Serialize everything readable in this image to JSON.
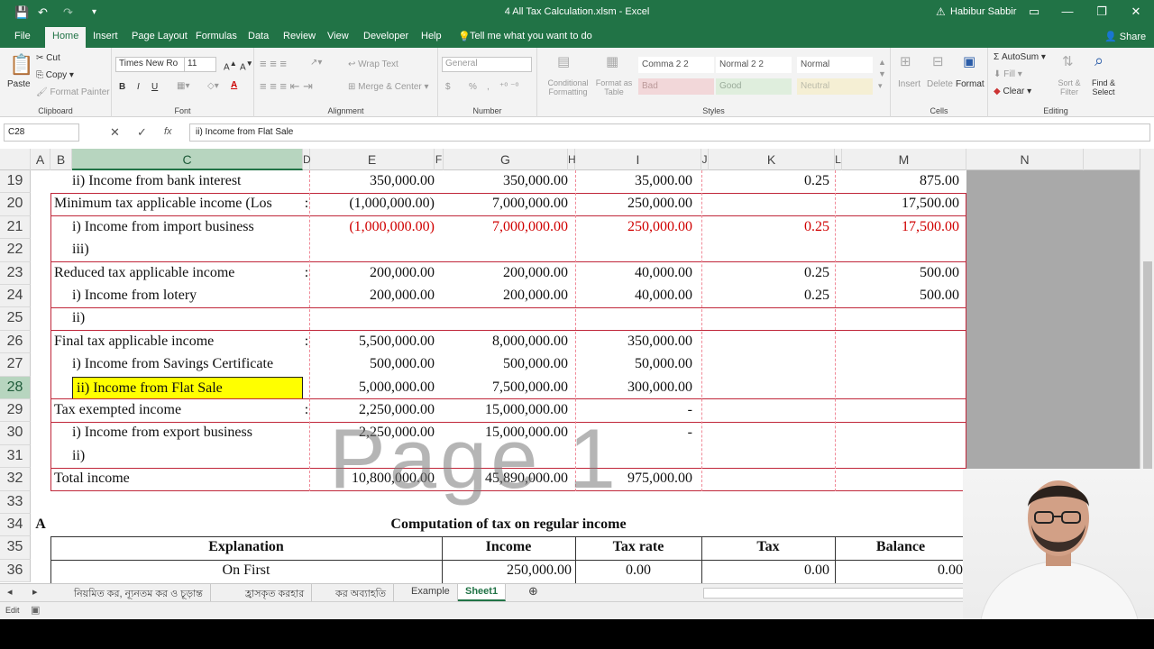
{
  "titlebar": {
    "title": "4 All Tax Calculation.xlsm  -  Excel",
    "user": "Habibur Sabbir",
    "save_icon": "💾",
    "undo_icon": "↶",
    "redo_icon": "↷",
    "customize_icon": "▾",
    "warning_icon": "⚠",
    "ribbon_display_icon": "▭",
    "minimize_icon": "—",
    "restore_icon": "❐",
    "close_icon": "✕"
  },
  "menu_tabs": [
    "File",
    "Home",
    "Insert",
    "Page Layout",
    "Formulas",
    "Data",
    "Review",
    "View",
    "Developer",
    "Help"
  ],
  "tell_me": "Tell me what you want to do",
  "share": "Share",
  "ribbon": {
    "clipboard": {
      "paste": "Paste",
      "cut": "Cut",
      "copy": "Copy",
      "format_painter": "Format Painter",
      "label": "Clipboard"
    },
    "font": {
      "name": "Times New Ro",
      "size": "11",
      "bold": "B",
      "italic": "I",
      "underline": "U",
      "label": "Font"
    },
    "alignment": {
      "wrap": "Wrap Text",
      "merge": "Merge & Center",
      "label": "Alignment"
    },
    "number": {
      "format": "General",
      "currency": "$",
      "percent": "%",
      "comma": ",",
      "label": "Number"
    },
    "styles": {
      "conditional": "Conditional Formatting",
      "format_table": "Format as Table",
      "comma22": "Comma 2 2",
      "normal22": "Normal 2 2",
      "normal": "Normal",
      "bad": "Bad",
      "good": "Good",
      "neutral": "Neutral",
      "label": "Styles"
    },
    "cells": {
      "insert": "Insert",
      "delete": "Delete",
      "format": "Format",
      "label": "Cells"
    },
    "editing": {
      "autosum": "AutoSum",
      "fill": "Fill",
      "clear": "Clear",
      "sort": "Sort & Filter",
      "find": "Find & Select",
      "label": "Editing"
    }
  },
  "formula_bar": {
    "name_box": "C28",
    "cancel": "✕",
    "enter": "✓",
    "fx": "fx",
    "content": "ii) Income from Flat Sale"
  },
  "columns": [
    "A",
    "B",
    "C",
    "D",
    "E",
    "F",
    "G",
    "H",
    "I",
    "J",
    "K",
    "L",
    "M",
    "N"
  ],
  "rows": [
    {
      "num": "19",
      "c": "ii) Income from bank interest",
      "d": "",
      "e": "350,000.00",
      "g": "350,000.00",
      "i": "35,000.00",
      "k": "0.25",
      "m": "875.00"
    },
    {
      "num": "20",
      "c": "Minimum tax applicable income (Los",
      "d": ":",
      "e": "(1,000,000.00)",
      "g": "7,000,000.00",
      "i": "250,000.00",
      "k": "",
      "m": "17,500.00"
    },
    {
      "num": "21",
      "c": "i) Income from import business",
      "d": "",
      "e": "(1,000,000.00)",
      "g": "7,000,000.00",
      "i": "250,000.00",
      "k": "0.25",
      "m": "17,500.00"
    },
    {
      "num": "22",
      "c": "iii)",
      "d": "",
      "e": "",
      "g": "",
      "i": "",
      "k": "",
      "m": ""
    },
    {
      "num": "23",
      "c": "Reduced tax applicable income",
      "d": ":",
      "e": "200,000.00",
      "g": "200,000.00",
      "i": "40,000.00",
      "k": "0.25",
      "m": "500.00"
    },
    {
      "num": "24",
      "c": "i) Income from lotery",
      "d": "",
      "e": "200,000.00",
      "g": "200,000.00",
      "i": "40,000.00",
      "k": "0.25",
      "m": "500.00"
    },
    {
      "num": "25",
      "c": "ii)",
      "d": "",
      "e": "",
      "g": "",
      "i": "",
      "k": "",
      "m": ""
    },
    {
      "num": "26",
      "c": "Final tax applicable income",
      "d": ":",
      "e": "5,500,000.00",
      "g": "8,000,000.00",
      "i": "350,000.00",
      "k": "",
      "m": ""
    },
    {
      "num": "27",
      "c": "i) Income from Savings Certificate",
      "d": "",
      "e": "500,000.00",
      "g": "500,000.00",
      "i": "50,000.00",
      "k": "",
      "m": ""
    },
    {
      "num": "28",
      "c": "ii) Income from Flat Sale",
      "d": "",
      "e": "5,000,000.00",
      "g": "7,500,000.00",
      "i": "300,000.00",
      "k": "",
      "m": ""
    },
    {
      "num": "29",
      "c": "Tax exempted income",
      "d": ":",
      "e": "2,250,000.00",
      "g": "15,000,000.00",
      "i": "-",
      "k": "",
      "m": ""
    },
    {
      "num": "30",
      "c": "i) Income from export business",
      "d": "",
      "e": "2,250,000.00",
      "g": "15,000,000.00",
      "i": "-",
      "k": "",
      "m": ""
    },
    {
      "num": "31",
      "c": "ii)",
      "d": "",
      "e": "",
      "g": "",
      "i": "",
      "k": "",
      "m": ""
    },
    {
      "num": "32",
      "c": "Total income",
      "d": "",
      "e": "10,800,000.00",
      "g": "45,890,000.00",
      "i": "975,000.00",
      "k": "",
      "m": ""
    },
    {
      "num": "33",
      "c": "",
      "d": "",
      "e": "",
      "g": "",
      "i": "",
      "k": "",
      "m": ""
    }
  ],
  "row34": {
    "num": "34",
    "a": "A",
    "title": "Computation of tax on regular income"
  },
  "row35": {
    "num": "35",
    "explanation": "Explanation",
    "income": "Income",
    "tax_rate": "Tax rate",
    "tax": "Tax",
    "balance": "Balance"
  },
  "row36": {
    "num": "36",
    "explanation": "On First",
    "income": "250,000.00",
    "tax_rate": "0.00",
    "tax": "0.00",
    "balance": "0.00"
  },
  "watermark": "Page 1",
  "sheet_tabs": [
    "নিয়মিত কর, ন্যূনতম কর ও চূড়ান্ত",
    "হ্রাসকৃত করহার",
    "কর অব্যাহতি",
    "Example",
    "Sheet1"
  ],
  "add_sheet": "⊕",
  "status": {
    "mode": "Edit"
  },
  "colors": {
    "excel_green": "#217346",
    "border_red": "#c0273a",
    "negative_red": "#d00000",
    "highlight_yellow": "#ffff00"
  }
}
